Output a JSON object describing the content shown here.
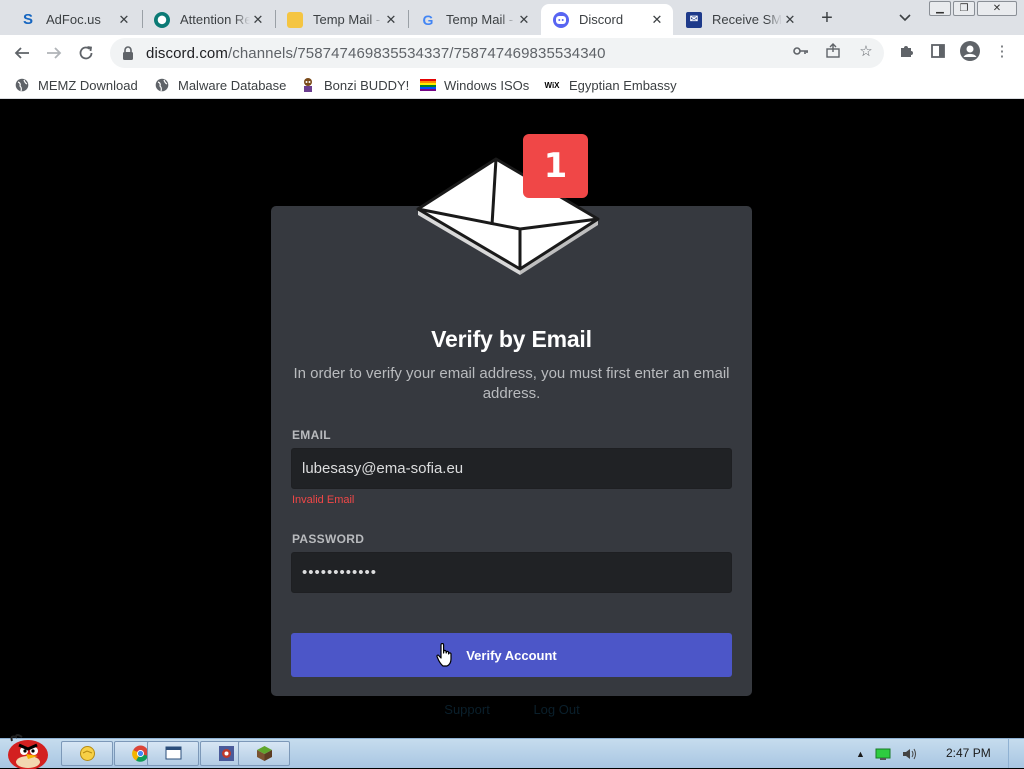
{
  "browser": {
    "tabs": [
      {
        "title": "AdFoc.us",
        "favicon": "adfocus-icon",
        "color": "#1565c0"
      },
      {
        "title": "Attention Required",
        "favicon": "cloudflare-icon",
        "color": "#0b7a75"
      },
      {
        "title": "Temp Mail - Disposable",
        "favicon": "tempmail-icon",
        "color": "#f5c542"
      },
      {
        "title": "Temp Mail - Google",
        "favicon": "google-icon",
        "color": "#4285f4"
      },
      {
        "title": "Discord",
        "favicon": "discord-icon",
        "color": "#5865f2"
      },
      {
        "title": "Receive SMS Online",
        "favicon": "sms-icon",
        "color": "#1e3a8a"
      }
    ],
    "active_tab": 4,
    "url_host": "discord.com",
    "url_path": "/channels/758747469835534337/758747469835534340",
    "bookmarks": [
      {
        "label": "MEMZ Download",
        "icon": "globe-icon"
      },
      {
        "label": "Malware Database",
        "icon": "globe-icon"
      },
      {
        "label": "Bonzi BUDDY!",
        "icon": "bonzi-icon"
      },
      {
        "label": "Windows ISOs",
        "icon": "rainbow-flag-icon"
      },
      {
        "label": "Egyptian Embassy",
        "icon": "wix-icon"
      }
    ]
  },
  "modal": {
    "badge": "1",
    "title": "Verify by Email",
    "subtitle": "In order to verify your email address, you must first enter an email address.",
    "email_label": "EMAIL",
    "email_value": "lubesasy@ema-sofia.eu",
    "email_error": "Invalid Email",
    "password_label": "PASSWORD",
    "password_value": "••••••••••••",
    "submit_label": "Verify Account"
  },
  "footer": {
    "support": "Support",
    "logout": "Log Out"
  },
  "taskbar": {
    "clock": "2:47 PM",
    "apps": [
      "explorer-icon",
      "chrome-icon",
      "window-icon",
      "paint-icon",
      "minecraft-icon"
    ]
  },
  "colors": {
    "discord_blurple": "#5865f2",
    "error_red": "#f04747",
    "card_bg": "#36393f",
    "input_bg": "#202225"
  }
}
